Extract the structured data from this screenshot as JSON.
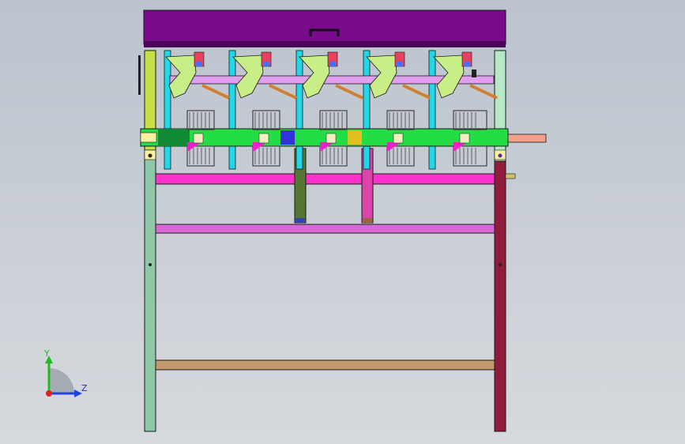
{
  "viewport": {
    "background_top": "#bcc3cd",
    "background_bottom": "#d6dade"
  },
  "model": {
    "colors": {
      "top_cover": "#7a0a8c",
      "top_cover_edge": "#4a0458",
      "left_column": "#8fc7a9",
      "left_column_top": "#c8e048",
      "right_column": "#8e1c3a",
      "right_column_top": "#b6e8c8",
      "cross_beam_1": "#ff33cc",
      "cross_beam_2": "#d86ad8",
      "cross_beam_3": "#c09a6c",
      "shaft": "#22dd44",
      "shaft_dark": "#118833",
      "shaft_end": "#f0a088",
      "upper_rail": "#e0a0f0",
      "posts": "#20d8e8",
      "hoppers": "#c8ee88",
      "modules": "#444444",
      "vertical_support_1": "#557733",
      "vertical_support_2": "#dd44aa"
    },
    "station_count": 5
  },
  "triad": {
    "y_label": "Y",
    "z_label": "Z",
    "y_color": "#22bb22",
    "z_color": "#2244dd",
    "x_color": "#dd2222"
  }
}
